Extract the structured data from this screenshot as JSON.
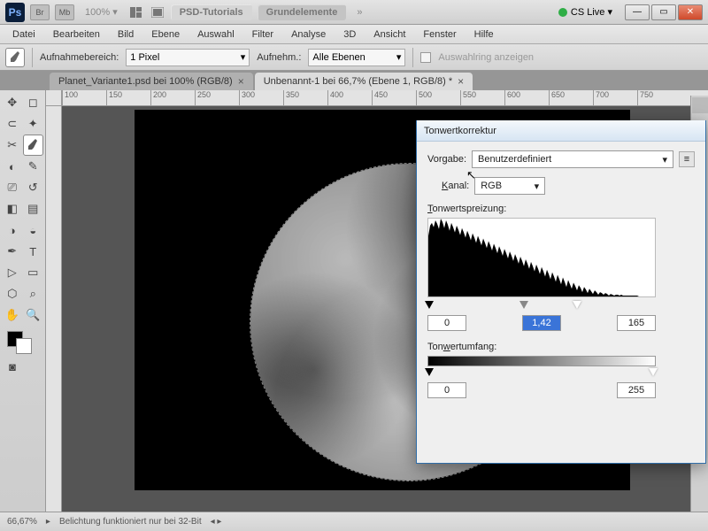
{
  "titlebar": {
    "ps": "Ps",
    "br": "Br",
    "mb": "Mb",
    "zoom": "100% ▾",
    "psd_tutorials": "PSD-Tutorials",
    "grundelemente": "Grundelemente",
    "more": "»",
    "cslive": "CS Live ▾"
  },
  "menu": [
    "Datei",
    "Bearbeiten",
    "Bild",
    "Ebene",
    "Auswahl",
    "Filter",
    "Analyse",
    "3D",
    "Ansicht",
    "Fenster",
    "Hilfe"
  ],
  "options": {
    "aufnahmebereich_label": "Aufnahmebereich:",
    "aufnahmebereich_value": "1 Pixel",
    "aufnehm_label": "Aufnehm.:",
    "aufnehm_value": "Alle Ebenen",
    "auswahlring": "Auswahlring anzeigen"
  },
  "tabs": {
    "inactive": "Planet_Variante1.psd bei 100% (RGB/8)",
    "active": "Unbenannt-1 bei 66,7% (Ebene 1, RGB/8) *"
  },
  "ruler": [
    "100",
    "150",
    "200",
    "250",
    "300",
    "350",
    "400",
    "450",
    "500",
    "550",
    "600",
    "650",
    "700",
    "750"
  ],
  "status": {
    "zoom": "66,67%",
    "msg": "Belichtung funktioniert nur bei 32-Bit"
  },
  "dialog": {
    "title": "Tonwertkorrektur",
    "vorgabe_label": "Vorgabe:",
    "vorgabe_value": "Benutzerdefiniert",
    "kanal_label": "Kanal:",
    "kanal_value": "RGB",
    "tonwertspreizung": "Tonwertspreizung:",
    "in_black": "0",
    "in_gamma": "1,42",
    "in_white": "165",
    "tonwertumfang": "Tonwertumfang:",
    "out_black": "0",
    "out_white": "255"
  },
  "chart_data": {
    "type": "area",
    "title": "Tonwertspreizung:",
    "xlabel": "",
    "ylabel": "",
    "x_range": [
      0,
      255
    ],
    "input_sliders": {
      "black": 0,
      "gamma": 1.42,
      "white": 165
    },
    "output_sliders": {
      "black": 0,
      "white": 255
    },
    "histogram_bins": [
      70,
      82,
      85,
      80,
      88,
      84,
      78,
      90,
      86,
      79,
      88,
      83,
      76,
      85,
      80,
      74,
      82,
      77,
      71,
      79,
      74,
      68,
      76,
      71,
      65,
      73,
      68,
      62,
      70,
      65,
      59,
      67,
      62,
      56,
      64,
      59,
      53,
      61,
      56,
      50,
      58,
      53,
      47,
      55,
      50,
      44,
      52,
      47,
      41,
      49,
      44,
      38,
      46,
      41,
      35,
      43,
      38,
      32,
      40,
      35,
      29,
      37,
      32,
      26,
      34,
      29,
      23,
      31,
      26,
      20,
      28,
      23,
      17,
      25,
      20,
      14,
      22,
      17,
      11,
      19,
      14,
      9,
      16,
      12,
      7,
      13,
      10,
      5,
      11,
      8,
      4,
      9,
      6,
      3,
      7,
      5,
      2,
      5,
      4,
      2,
      4,
      3,
      1,
      3,
      2,
      1,
      2,
      2,
      1,
      2,
      1,
      1,
      1,
      1,
      1,
      1,
      1,
      1,
      1,
      0,
      0,
      0,
      0,
      0,
      0,
      0,
      0,
      0
    ]
  }
}
